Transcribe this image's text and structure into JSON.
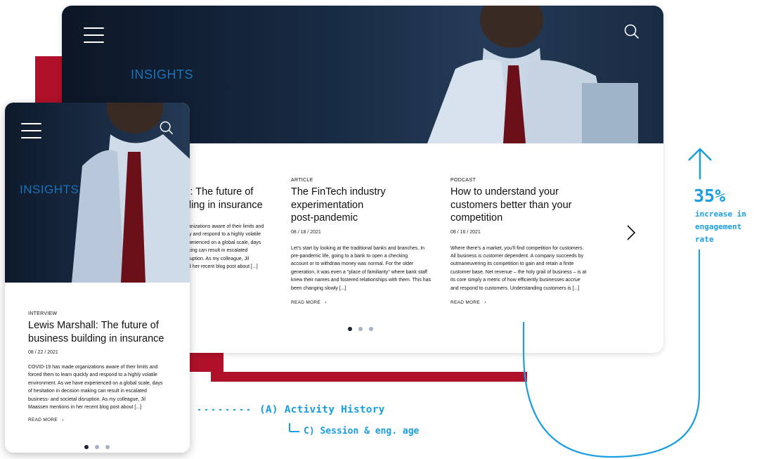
{
  "desktop": {
    "heading": "INSIGHTS",
    "cards": [
      {
        "title_line1": "ll: The future of",
        "title_line2": "ding in insurance",
        "body": [
          "ganizations aware of their limits and",
          "kly and respond to a highly volatile",
          "xperienced on a global scale, days",
          "aking can result in escalated",
          "sruption.  As my colleague, Jil",
          "ed her recent blog post about [...]"
        ]
      },
      {
        "tag": "ARTICLE",
        "title_lines": [
          "The FinTech industry",
          "experimentation",
          "post-pandemic"
        ],
        "date": "08 / 18 / 2021",
        "body": [
          "Let's start by looking at the traditional banks and branches. In",
          "pre-pandemic life, going to a bank to open a checking",
          "account or to withdraw money was normal. For the older",
          "generation, it was even a \"place of familiarity\" where bank staff",
          "knew their names and fostered relationships with them. This has",
          "been changing slowly [...]"
        ],
        "read_more": "READ MORE"
      },
      {
        "tag": "PODCAST",
        "title_lines": [
          "How to understand your",
          "customers better than your",
          "competition"
        ],
        "date": "08 / 16 / 2021",
        "body": [
          "Where there's a market, you'll find competition for customers.",
          "All business is customer dependent. A company succeeds by",
          "outmaneuvering its competition to gain and retain a finite",
          "customer base. Net revenue – the holy grail of business – is at",
          "its core simply a metric of how efficiently businesses accrue",
          "and respond to customers. Understanding customers is [...]"
        ],
        "read_more": "READ MORE"
      }
    ]
  },
  "mobile": {
    "heading": "INSIGHTS",
    "card": {
      "tag": "INTERVIEW",
      "title_lines": [
        "Lewis Marshall: The future of",
        "business building in insurance"
      ],
      "date": "08 / 22 / 2021",
      "body": [
        "COVID-19 has made organizations aware of their limits and",
        "forced them to learn quickly and respond to a highly volatile",
        "environment. As we have experienced on a global scale, days",
        "of hesitation in decision making can result in escalated",
        "business- and societal disruption.  As my colleague, Jil",
        "Maassen mentions in her recent blog post about [...]"
      ],
      "read_more": "READ MORE"
    }
  },
  "annotations": {
    "activity": "(A) Activity History",
    "second": "C) Session & eng. age",
    "stat_value": "35%",
    "stat_lines": [
      "increase in",
      "engagement",
      "rate"
    ]
  },
  "colors": {
    "accent_red": "#b0112a",
    "insights_blue": "#1a73b8",
    "annotation_blue": "#1a9ee0"
  }
}
